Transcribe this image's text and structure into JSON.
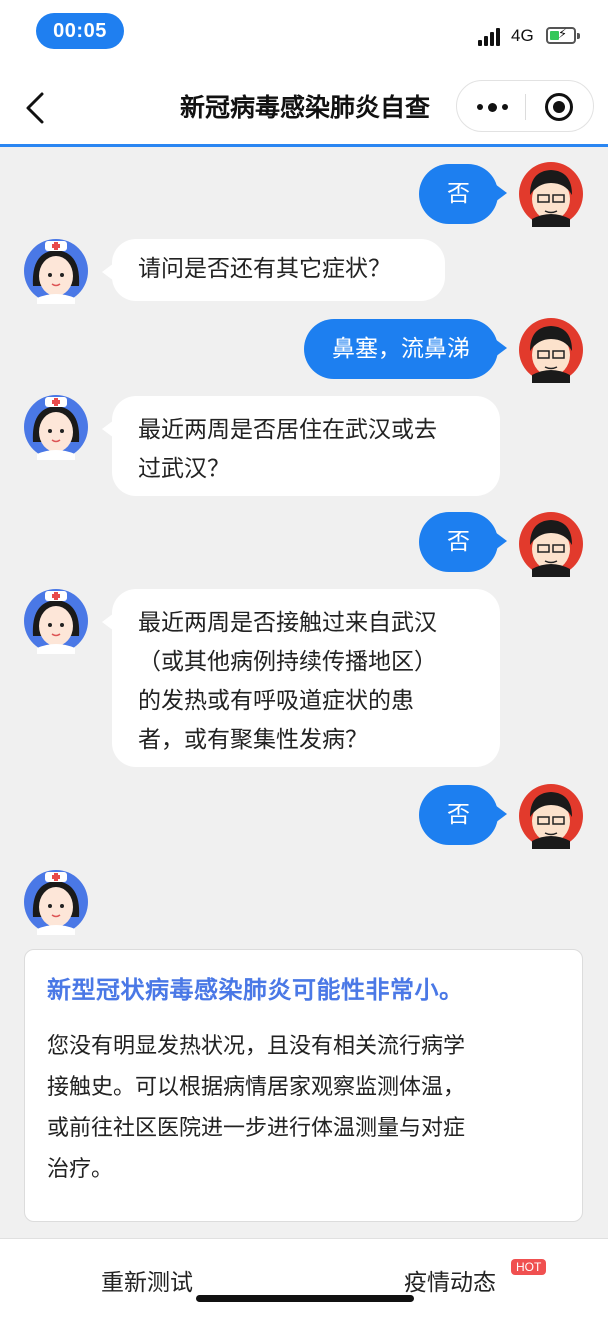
{
  "status_bar": {
    "time": "00:05",
    "network": "4G"
  },
  "nav": {
    "title": "新冠病毒感染肺炎自查"
  },
  "chat": {
    "messages": [
      {
        "from": "user",
        "text": "否"
      },
      {
        "from": "bot",
        "text": "请问是否还有其它症状？"
      },
      {
        "from": "user",
        "text": "鼻塞，流鼻涕"
      },
      {
        "from": "bot",
        "lines": [
          "最近两周是否居住在武汉或去",
          "过武汉？"
        ]
      },
      {
        "from": "user",
        "text": "否"
      },
      {
        "from": "bot",
        "lines": [
          "最近两周是否接触过来自武汉",
          "（或其他病例持续传播地区）",
          "的发热或有呼吸道症状的患",
          "者，或有聚集性发病？"
        ]
      },
      {
        "from": "user",
        "text": "否"
      }
    ],
    "result": {
      "title": "新型冠状病毒感染肺炎可能性非常小。",
      "body_lines": [
        "您没有明显发热状况，且没有相关流行病学",
        "接触史。可以根据病情居家观察监测体温，",
        "或前往社区医院进一步进行体温测量与对症",
        "治疗。"
      ]
    }
  },
  "bottom_bar": {
    "retest_label": "重新测试",
    "epidemic_label": "疫情动态",
    "hot_badge": "HOT"
  },
  "colors": {
    "accent": "#1d7ff0",
    "result_title": "#4a78e6",
    "background": "#f0f0f0",
    "hot": "#f05050"
  }
}
